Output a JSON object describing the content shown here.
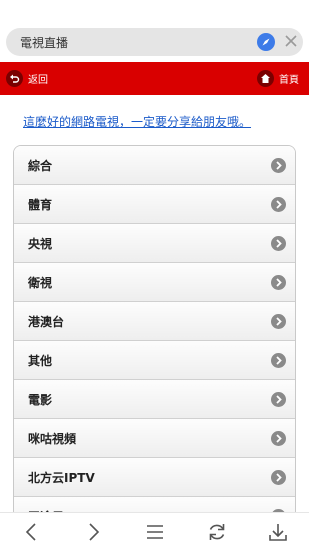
{
  "browser": {
    "search_text": "電視直播",
    "compass_icon": "compass-icon",
    "clear_icon": "close-icon"
  },
  "header": {
    "back_label": "返回",
    "home_label": "首頁",
    "bar_color": "#d90000"
  },
  "share_text": "這麼好的網路電視，一定要分享給朋友哦。",
  "categories": [
    {
      "label": "綜合"
    },
    {
      "label": "體育"
    },
    {
      "label": "央視"
    },
    {
      "label": "衛視"
    },
    {
      "label": "港澳台"
    },
    {
      "label": "其他"
    },
    {
      "label": "電影"
    },
    {
      "label": "咪咕視頻"
    },
    {
      "label": "北方云IPTV"
    },
    {
      "label": "天途云IPTV"
    }
  ],
  "bottom_nav": [
    "back-arrow-icon",
    "forward-arrow-icon",
    "menu-icon",
    "refresh-icon",
    "download-icon"
  ]
}
